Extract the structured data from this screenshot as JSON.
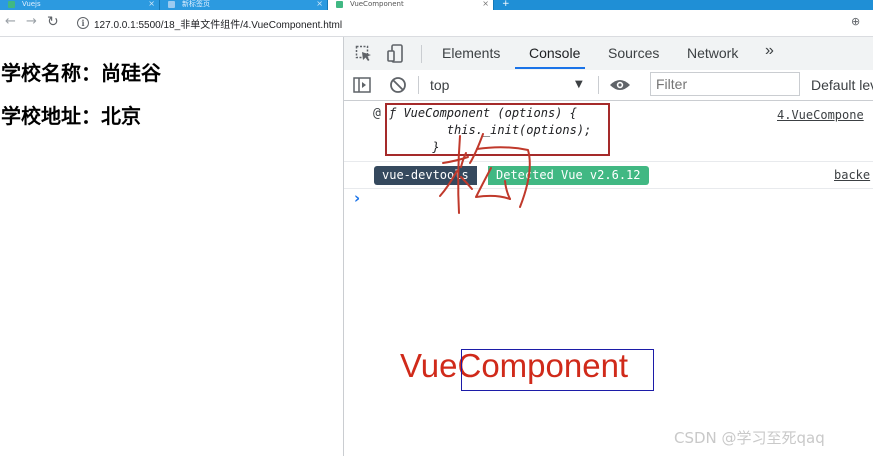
{
  "browser": {
    "tabs": [
      {
        "title": "Vuejs",
        "active": false
      },
      {
        "title": "新标签页",
        "active": false
      },
      {
        "title": "VueComponent",
        "active": true
      }
    ],
    "new_tab": "+",
    "url": "127.0.0.1:5500/18_非单文件组件/4.VueComponent.html"
  },
  "page": {
    "school_name": "学校名称：尚硅谷",
    "school_address": "学校地址：北京"
  },
  "devtools": {
    "tabs": [
      "Elements",
      "Console",
      "Sources",
      "Network"
    ],
    "more": "»",
    "active_tab": "Console",
    "context": "top",
    "filter_placeholder": "Filter",
    "levels": "Default lev",
    "messages": {
      "fn_prefix": "@",
      "fn_line1": "ƒ VueComponent (options) {",
      "fn_line2": "        this._init(options);",
      "fn_line3": "      }",
      "fn_source": "4.VueCompone",
      "badge_left": "vue-devtools",
      "badge_right": "Detected Vue v2.6.12",
      "badge_source": "backe"
    },
    "prompt": "›"
  },
  "annotation": {
    "text": "VueComponent",
    "handwritten_char": "构",
    "color": "#d02a1a"
  },
  "watermark": "CSDN @学习至死qaq"
}
